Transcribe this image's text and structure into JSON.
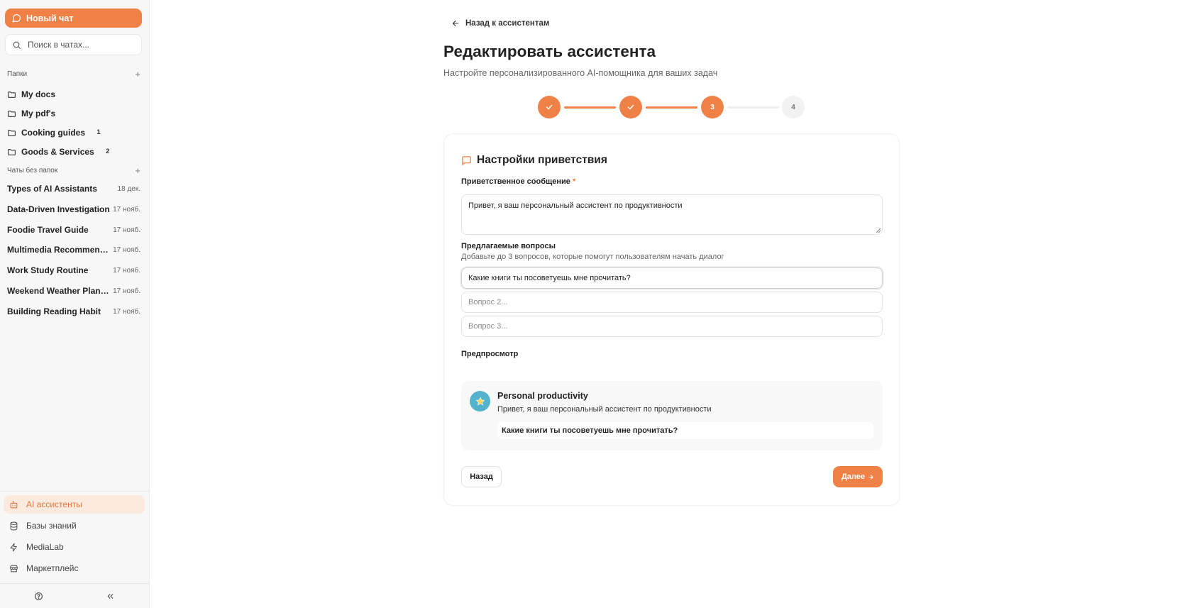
{
  "sidebar": {
    "new_chat_label": "Новый чат",
    "search_placeholder": "Поиск в чатах...",
    "folders_header": "Папки",
    "folders": [
      {
        "name": "My docs",
        "count": ""
      },
      {
        "name": "My pdf's",
        "count": ""
      },
      {
        "name": "Cooking guides",
        "count": "1"
      },
      {
        "name": "Goods & Services",
        "count": "2"
      }
    ],
    "chats_header": "Чаты без папок",
    "chats": [
      {
        "title": "Types of AI Assistants",
        "date": "18 дек."
      },
      {
        "title": "Data-Driven Investigation",
        "date": "17 нояб."
      },
      {
        "title": "Foodie Travel Guide",
        "date": "17 нояб."
      },
      {
        "title": "Multimedia Recommendati...",
        "date": "17 нояб."
      },
      {
        "title": "Work Study Routine",
        "date": "17 нояб."
      },
      {
        "title": "Weekend Weather Planner",
        "date": "17 нояб."
      },
      {
        "title": "Building Reading Habit",
        "date": "17 нояб."
      }
    ],
    "nav": [
      {
        "label": "AI ассистенты",
        "icon": "bot-icon",
        "active": true
      },
      {
        "label": "Базы знаний",
        "icon": "database-icon",
        "active": false
      },
      {
        "label": "MediaLab",
        "icon": "lightning-icon",
        "active": false
      },
      {
        "label": "Маркетплейс",
        "icon": "store-icon",
        "active": false
      }
    ]
  },
  "main": {
    "back_label": "Назад к ассистентам",
    "title": "Редактировать ассистента",
    "subtitle": "Настройте персонализированного AI-помощника для ваших задач",
    "steps": [
      {
        "label": "",
        "state": "done"
      },
      {
        "label": "",
        "state": "done"
      },
      {
        "label": "3",
        "state": "current"
      },
      {
        "label": "4",
        "state": "todo"
      }
    ],
    "card": {
      "title": "Настройки приветствия",
      "greeting_label": "Приветственное сообщение",
      "required_mark": "*",
      "greeting_value": "Привет, я ваш персональный ассистент по продуктивности",
      "questions_label": "Предлагаемые вопросы",
      "questions_hint": "Добавьте до 3 вопросов, которые помогут пользователям начать диалог",
      "question_1_value": "Какие книги ты посоветуешь мне прочитать?",
      "question_2_placeholder": "Вопрос 2...",
      "question_3_placeholder": "Вопрос 3...",
      "preview_label": "Предпросмотр",
      "preview_name": "Personal productivity",
      "preview_message": "Привет, я ваш персональный ассистент по продуктивности",
      "preview_question": "Какие книги ты посоветуешь мне прочитать?",
      "back_button": "Назад",
      "next_button": "Далее"
    }
  },
  "colors": {
    "accent": "#f08146",
    "accent_soft": "#fdeadf",
    "avatar": "#54b3cc"
  }
}
